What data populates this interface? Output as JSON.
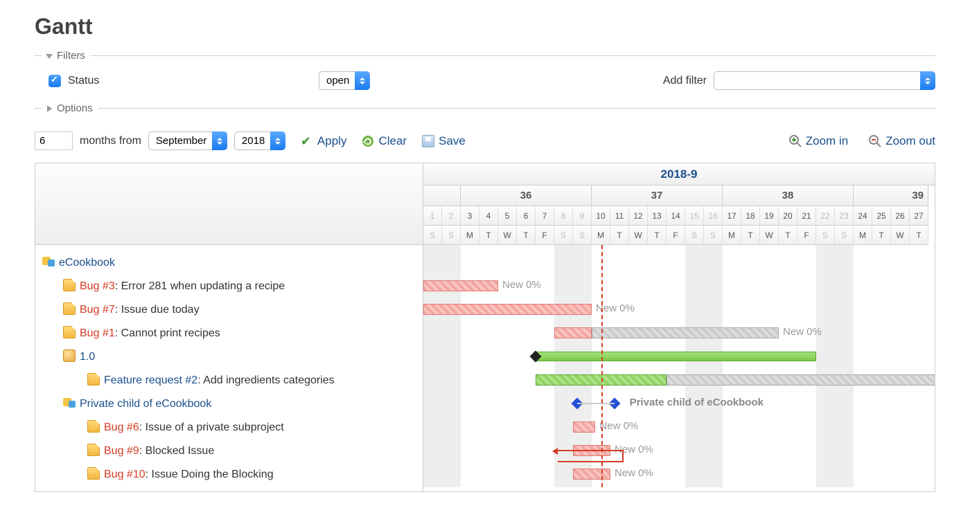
{
  "page_title": "Gantt",
  "filters_label": "Filters",
  "options_label": "Options",
  "status_filter": {
    "label": "Status",
    "value": "open"
  },
  "add_filter_label": "Add filter",
  "months_input": "6",
  "months_from_label": "months from",
  "month_select": "September",
  "year_select": "2018",
  "apply_label": "Apply",
  "clear_label": "Clear",
  "save_label": "Save",
  "zoom_in_label": "Zoom in",
  "zoom_out_label": "Zoom out",
  "calendar": {
    "month_label": "2018-9",
    "weeks": [
      36,
      37,
      38,
      39
    ],
    "days_num": [
      1,
      2,
      3,
      4,
      5,
      6,
      7,
      8,
      9,
      10,
      11,
      12,
      13,
      14,
      15,
      16,
      17,
      18,
      19,
      20,
      21,
      22,
      23,
      24,
      25,
      26,
      27
    ],
    "days_dow": [
      "S",
      "S",
      "M",
      "T",
      "W",
      "T",
      "F",
      "S",
      "S",
      "M",
      "T",
      "W",
      "T",
      "F",
      "S",
      "S",
      "M",
      "T",
      "W",
      "T",
      "F",
      "S",
      "S",
      "M",
      "T",
      "W",
      "T"
    ],
    "weekend_cols": [
      0,
      1,
      7,
      8,
      14,
      15,
      21,
      22
    ],
    "today_col": 9
  },
  "rows": [
    {
      "type": "project",
      "label": "eCookbook",
      "indent": 0
    },
    {
      "type": "issue",
      "tracker": "Bug #3",
      "subject": "Error 281 when updating a recipe",
      "indent": 1,
      "bar": {
        "style": "red",
        "start": 0,
        "len": 4,
        "label": "New 0%"
      }
    },
    {
      "type": "issue",
      "tracker": "Bug #7",
      "subject": "Issue due today",
      "indent": 1,
      "bar": {
        "style": "red",
        "start": 0,
        "len": 9,
        "label": "New 0%"
      }
    },
    {
      "type": "issue",
      "tracker": "Bug #1",
      "subject": "Cannot print recipes",
      "indent": 1,
      "bar": {
        "style": "red",
        "start": 7,
        "len": 2,
        "graystart": 9,
        "graylen": 10,
        "label": "New 0%"
      }
    },
    {
      "type": "version",
      "label": "1.0",
      "indent": 1,
      "bar": {
        "style": "green",
        "start": 6,
        "len": 15,
        "diamond": true
      }
    },
    {
      "type": "issue",
      "tracker": "Feature request #2",
      "subject": "Add ingredients categories",
      "indent": 2,
      "tracker_color": "blue",
      "bar": {
        "style": "greenhatch",
        "start": 6,
        "len": 7,
        "graystart": 13,
        "graylen": 30
      }
    },
    {
      "type": "project",
      "label": "Private child of eCookbook",
      "indent": 1,
      "bar": {
        "diamonds": [
          8,
          10
        ],
        "label": "Private child of eCookbook"
      }
    },
    {
      "type": "issue",
      "tracker": "Bug #6",
      "subject": "Issue of a private subproject",
      "indent": 2,
      "bar": {
        "style": "red",
        "start": 8,
        "len": 1.2,
        "label": "New 0%"
      }
    },
    {
      "type": "issue",
      "tracker": "Bug #9",
      "subject": "Blocked Issue",
      "indent": 2,
      "bar": {
        "style": "red",
        "start": 8,
        "len": 2,
        "label": "New 0%",
        "relation": true
      }
    },
    {
      "type": "issue",
      "tracker": "Bug #10",
      "subject": "Issue Doing the Blocking",
      "indent": 2,
      "bar": {
        "style": "red",
        "start": 8,
        "len": 2,
        "label": "New 0%"
      }
    }
  ]
}
